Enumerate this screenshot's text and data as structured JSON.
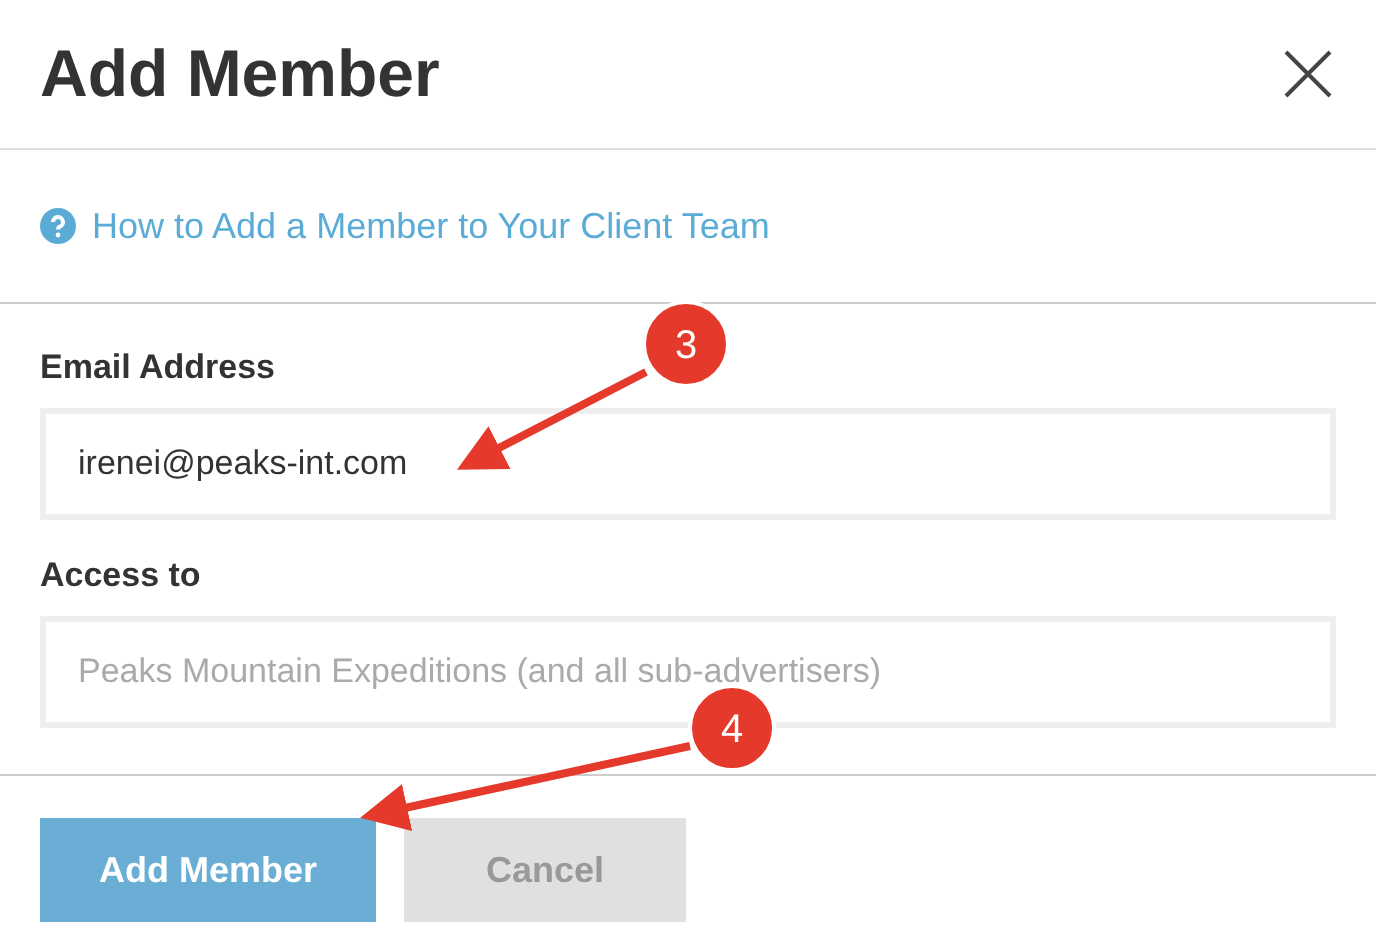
{
  "dialog": {
    "title": "Add Member",
    "help_link": "How to Add a Member to Your Client Team"
  },
  "fields": [
    {
      "label": "Email Address",
      "value": "irenei@peaks-int.com"
    },
    {
      "label": "Access to",
      "placeholder": "Peaks Mountain Expeditions (and all sub-advertisers)"
    }
  ],
  "buttons": [
    {
      "label": "Add Member",
      "kind": "primary"
    },
    {
      "label": "Cancel",
      "kind": "secondary"
    }
  ],
  "annotations": [
    {
      "label": "3"
    },
    {
      "label": "4"
    }
  ]
}
